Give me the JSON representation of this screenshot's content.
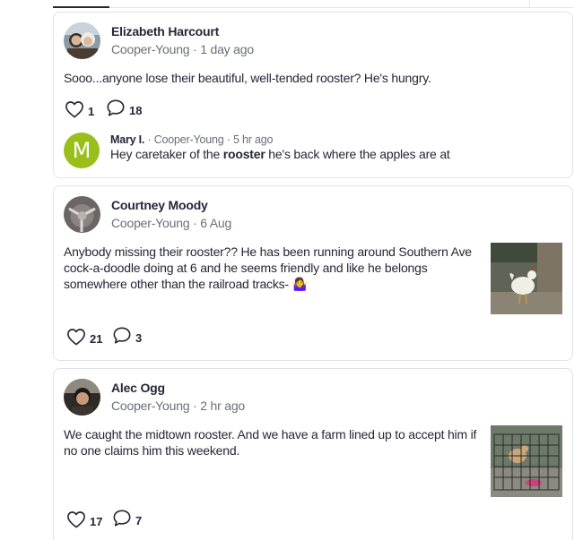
{
  "posts": [
    {
      "author": "Elizabeth Harcourt",
      "neighborhood": "Cooper-Young",
      "time": "1 day ago",
      "text": "Sooo...anyone lose their beautiful, well-tended rooster? He's hungry.",
      "likes": "1",
      "comments": "18",
      "reply": {
        "author": "Mary I.",
        "neighborhood": "Cooper-Young",
        "time": "5 hr ago",
        "text_before": "Hey caretaker of the ",
        "text_bold": "rooster",
        "text_after": " he's back where the apples are at",
        "avatar_letter": "M"
      }
    },
    {
      "author": "Courtney Moody",
      "neighborhood": "Cooper-Young",
      "time": "6 Aug",
      "text": "Anybody missing their rooster?? He has been running around Southern Ave cock-a-doodle doing at 6 and he seems friendly and like he belongs somewhere other than the railroad tracks- 🤷‍♀️",
      "likes": "21",
      "comments": "3"
    },
    {
      "author": "Alec Ogg",
      "neighborhood": "Cooper-Young",
      "time": "2 hr ago",
      "text": "We caught the midtown rooster. And we have a farm lined up to accept him if no one claims him this weekend.",
      "likes": "17",
      "comments": "7"
    }
  ],
  "icons": {
    "like": "heart-icon",
    "comment": "speech-bubble-icon"
  },
  "colors": {
    "reply_avatar": "#9bbf1a",
    "meta_text": "#6b6e78",
    "border": "#dfe2e6"
  }
}
